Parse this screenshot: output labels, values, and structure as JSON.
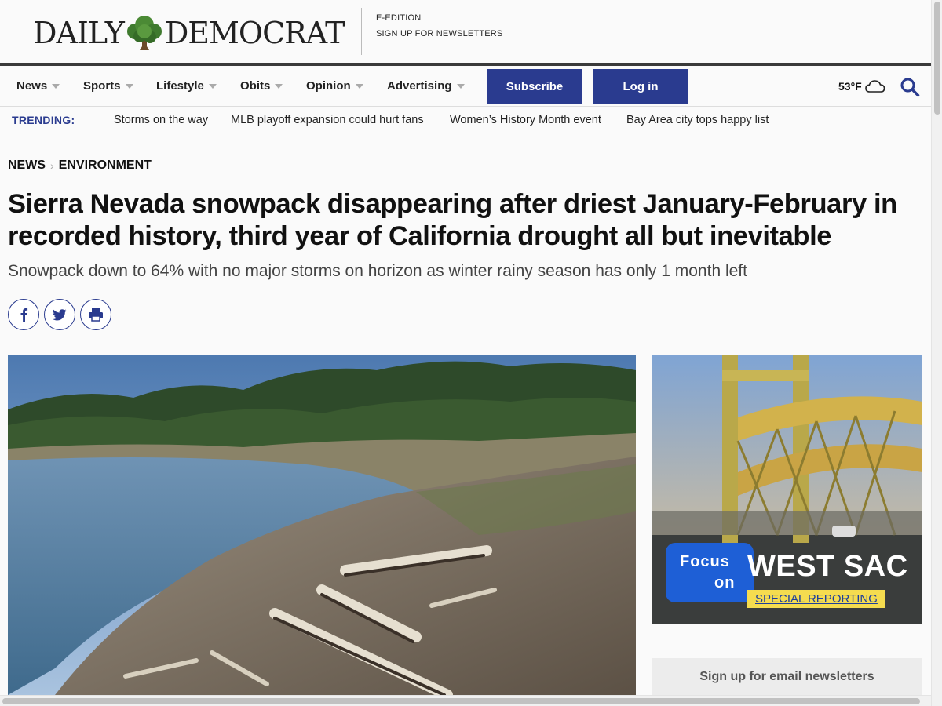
{
  "header": {
    "logo_left": "DAILY",
    "logo_right": "DEMOCRAT",
    "links": [
      "E-EDITION",
      "SIGN UP FOR NEWSLETTERS"
    ]
  },
  "nav": {
    "items": [
      {
        "label": "News"
      },
      {
        "label": "Sports"
      },
      {
        "label": "Lifestyle"
      },
      {
        "label": "Obits"
      },
      {
        "label": "Opinion"
      },
      {
        "label": "Advertising"
      }
    ],
    "subscribe_label": "Subscribe",
    "login_label": "Log in",
    "weather": "53°F",
    "weather_icon": "cloud-icon",
    "brand_color": "#2a3b8f"
  },
  "trending": {
    "label": "TRENDING:",
    "items": [
      "Storms on the way",
      "MLB playoff expansion could hurt fans",
      "Women’s History Month event",
      "Bay Area city tops happy list"
    ]
  },
  "article": {
    "breadcrumb": [
      "NEWS",
      "ENVIRONMENT"
    ],
    "headline": "Sierra Nevada snowpack disappearing after driest January-February in recorded history, third year of California drought all but inevitable",
    "subhead": "Snowpack down to 64% with no major storms on horizon as winter rainy season has only 1 month left",
    "share_icons": [
      "facebook-icon",
      "twitter-icon",
      "print-icon"
    ]
  },
  "ad": {
    "focus_line1": "Focus",
    "focus_line2": "on",
    "title": "WEST SAC",
    "link": "SPECIAL REPORTING"
  },
  "sidebar": {
    "newsletter_label": "Sign up for email newsletters"
  }
}
